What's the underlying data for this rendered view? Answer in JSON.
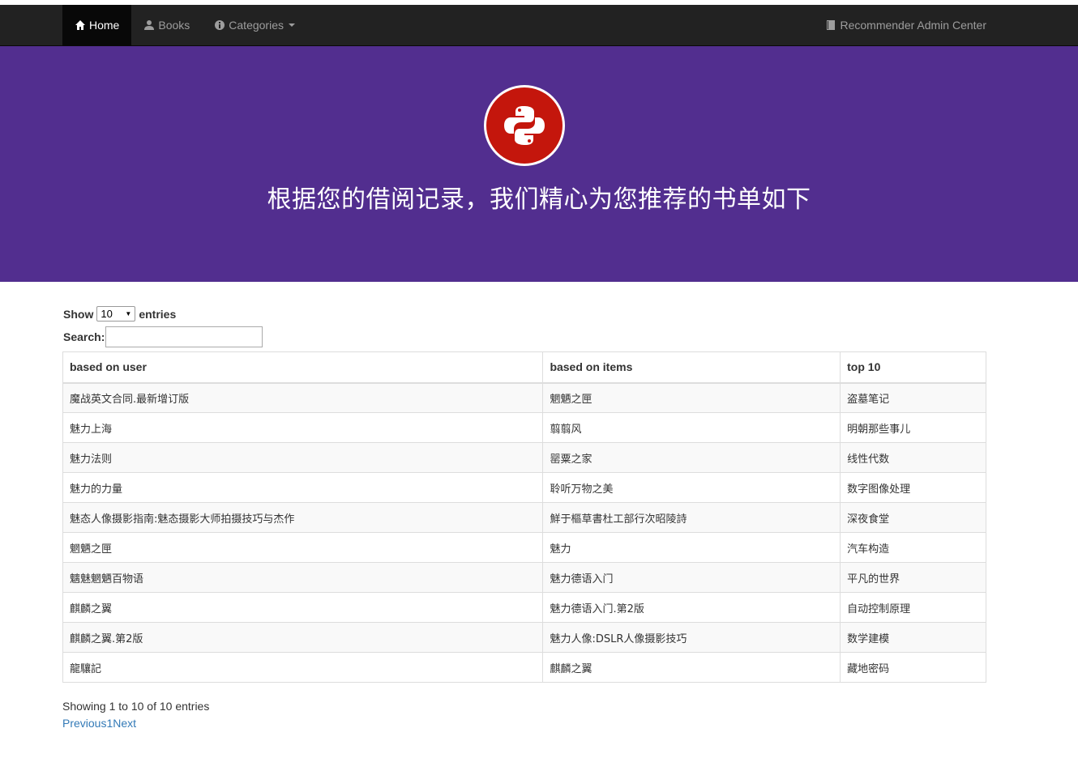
{
  "nav": {
    "home": "Home",
    "books": "Books",
    "categories": "Categories",
    "admin": "Recommender Admin Center"
  },
  "hero": {
    "title": "根据您的借阅记录，我们精心为您推荐的书单如下"
  },
  "table_controls": {
    "show_label": "Show",
    "entries_value": "10",
    "entries_label": "entries",
    "search_label": "Search:",
    "search_value": ""
  },
  "table": {
    "headers": [
      "based on user",
      "based on items",
      "top 10"
    ],
    "rows": [
      [
        "魔战英文合同.最新增订版",
        "魍魉之匣",
        "盗墓笔记"
      ],
      [
        "魅力上海",
        "翦翦风",
        "明朝那些事儿"
      ],
      [
        "魅力法则",
        "罂粟之家",
        "线性代数"
      ],
      [
        "魅力的力量",
        "聆听万物之美",
        "数字图像处理"
      ],
      [
        "魅态人像摄影指南:魅态摄影大师拍摄技巧与杰作",
        "鮮于樞草書杜工部行次昭陵詩",
        "深夜食堂"
      ],
      [
        "魍魉之匣",
        "魅力",
        "汽车构造"
      ],
      [
        "魑魅魍魉百物语",
        "魅力德语入门",
        "平凡的世界"
      ],
      [
        "麒麟之翼",
        "魅力德语入门.第2版",
        "自动控制原理"
      ],
      [
        "麒麟之翼.第2版",
        "魅力人像:DSLR人像摄影技巧",
        "数学建模"
      ],
      [
        "龍驤記",
        "麒麟之翼",
        "藏地密码"
      ]
    ]
  },
  "footer": {
    "info": "Showing 1 to 10 of 10 entries",
    "previous": "Previous",
    "page": "1",
    "next": "Next"
  }
}
